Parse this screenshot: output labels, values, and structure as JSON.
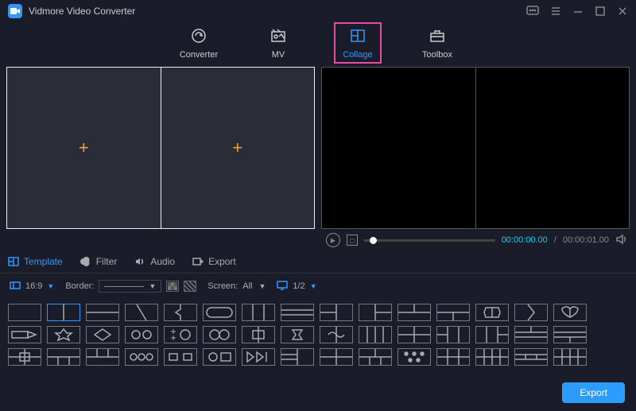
{
  "app": {
    "title": "Vidmore Video Converter"
  },
  "tabs": {
    "converter": "Converter",
    "mv": "MV",
    "collage": "Collage",
    "toolbox": "Toolbox"
  },
  "player": {
    "current": "00:00:00.00",
    "total": "00:00:01.00"
  },
  "subtabs": {
    "template": "Template",
    "filter": "Filter",
    "audio": "Audio",
    "export": "Export"
  },
  "options": {
    "aspect": "16:9",
    "border_label": "Border:",
    "screen_label": "Screen:",
    "screen_value": "All",
    "split": "1/2"
  },
  "footer": {
    "export": "Export"
  }
}
